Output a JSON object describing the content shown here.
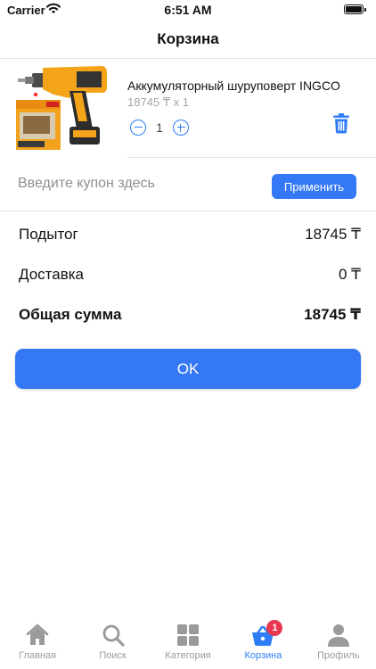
{
  "status_bar": {
    "carrier": "Carrier",
    "time": "6:51 AM"
  },
  "nav": {
    "title": "Корзина"
  },
  "cart": {
    "items": [
      {
        "name": "Аккумуляторный шуруповерт INGCO",
        "price_line": "18745 ₸ x 1",
        "quantity": "1"
      }
    ]
  },
  "coupon": {
    "placeholder": "Введите купон здесь",
    "apply_label": "Применить"
  },
  "summary": {
    "subtotal_label": "Подытог",
    "subtotal_value": "18745 ₸",
    "delivery_label": "Доставка",
    "delivery_value": "0 ₸",
    "total_label": "Общая сумма",
    "total_value": "18745 ₸"
  },
  "ok_label": "OK",
  "tabs": [
    {
      "label": "Главная",
      "icon": "home-icon"
    },
    {
      "label": "Поиск",
      "icon": "search-icon"
    },
    {
      "label": "Категория",
      "icon": "grid-icon"
    },
    {
      "label": "Корзина",
      "icon": "basket-icon",
      "badge": "1",
      "active": true
    },
    {
      "label": "Профиль",
      "icon": "person-icon"
    }
  ],
  "colors": {
    "accent": "#3478f6",
    "badge": "#e8384f",
    "inactive": "#9a9a9a",
    "muted_text": "#a5a5a5",
    "divider": "#e3e3e3"
  }
}
